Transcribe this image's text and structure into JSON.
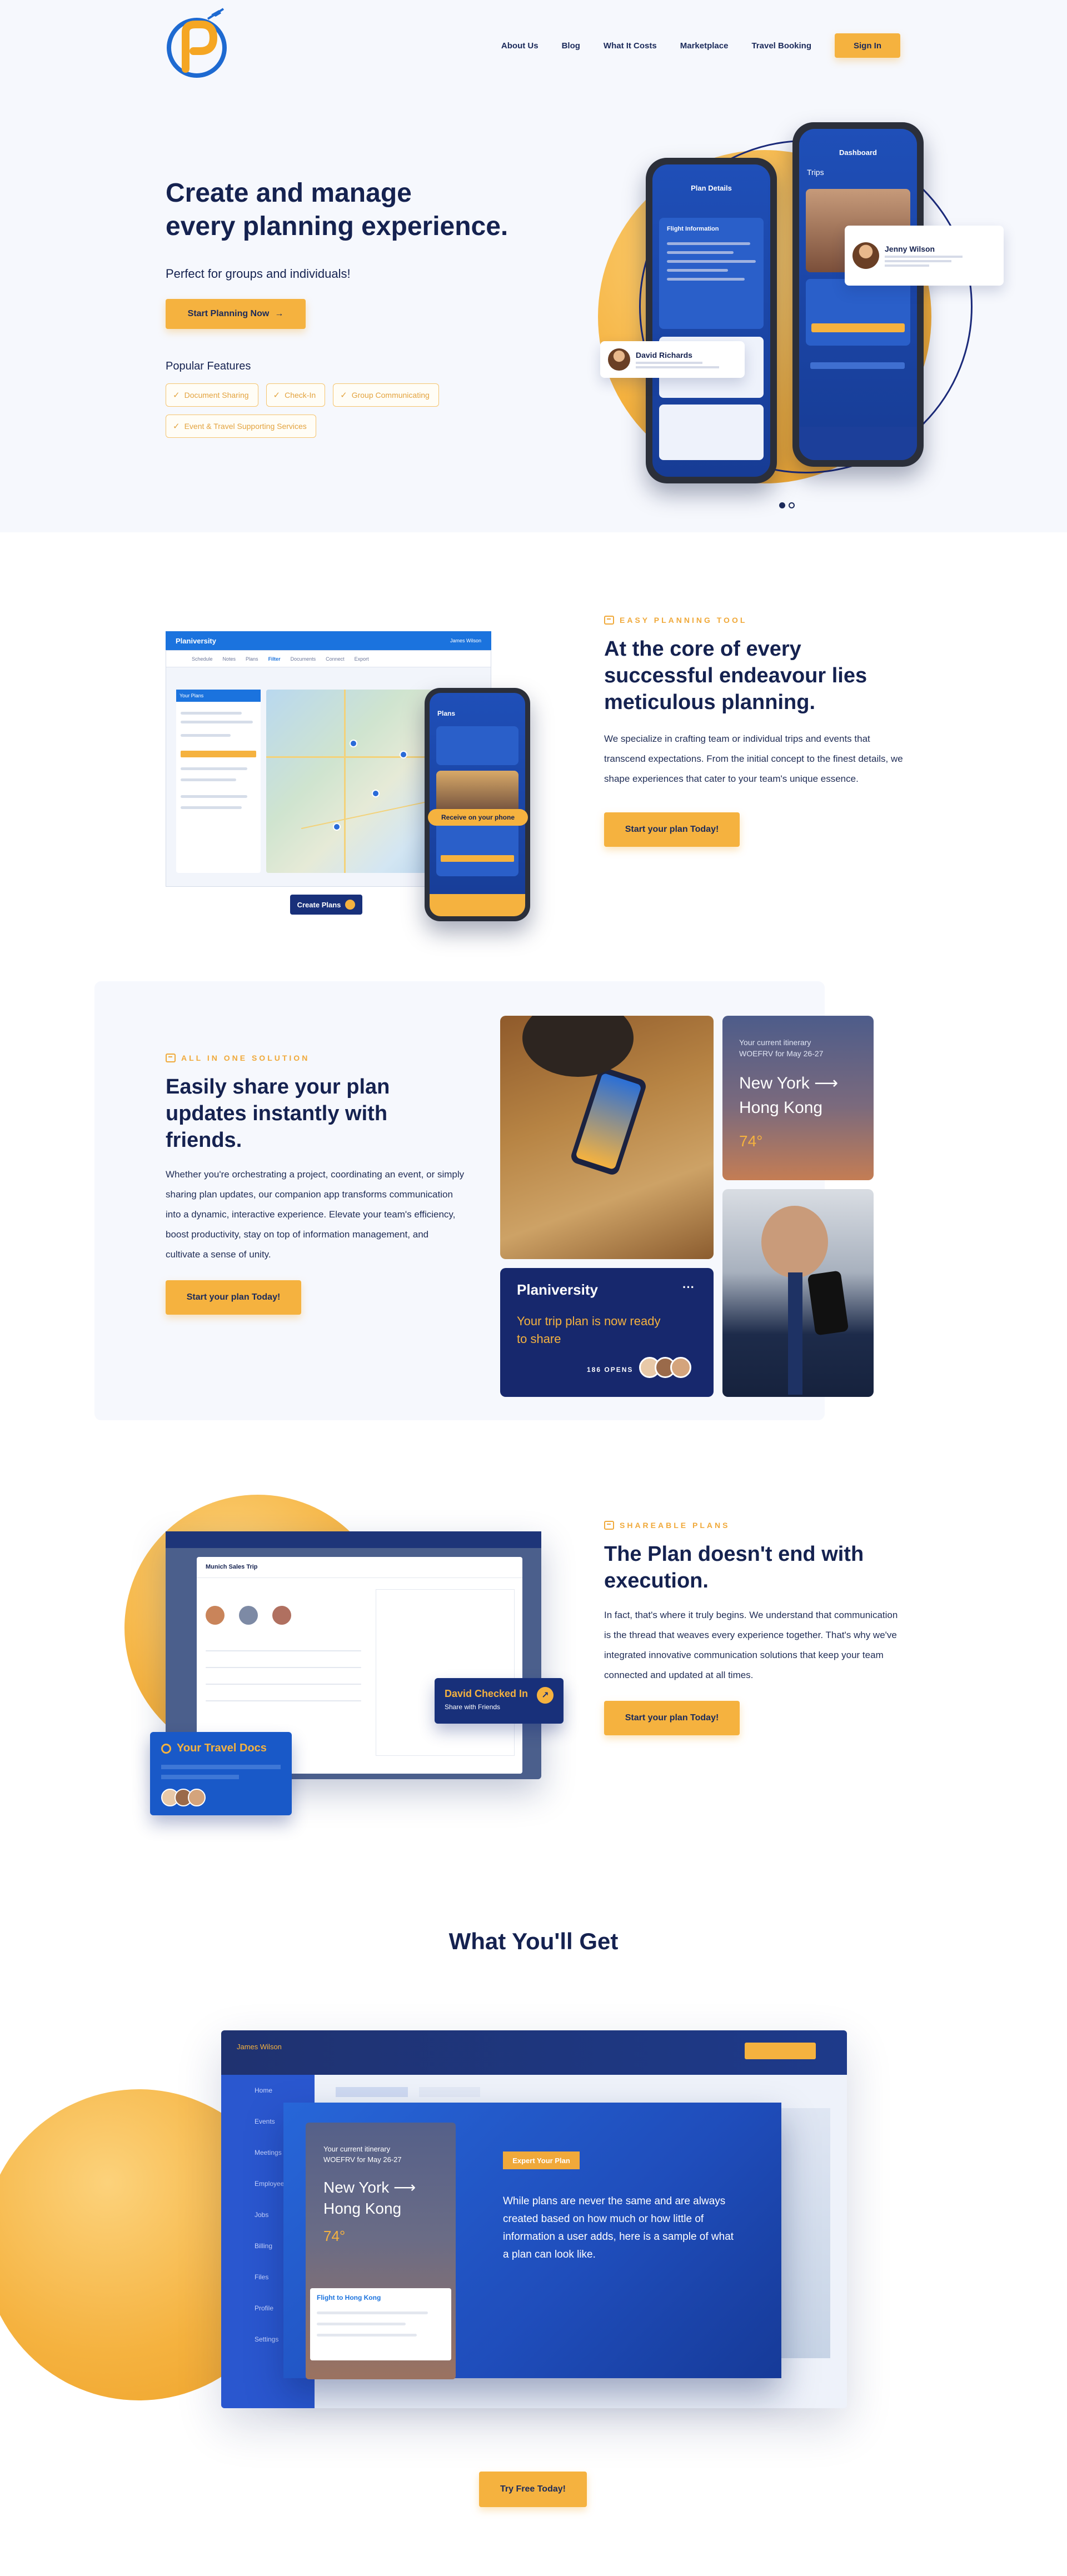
{
  "nav": {
    "links": [
      "About Us",
      "Blog",
      "What It Costs",
      "Marketplace",
      "Travel Booking"
    ],
    "signin": "Sign In"
  },
  "hero": {
    "title_line1": "Create and manage",
    "title_line2": "every planning experience.",
    "subtitle": "Perfect for groups and individuals!",
    "cta": "Start Planning Now",
    "popular_title": "Popular Features",
    "features": [
      "Document Sharing",
      "Check-In",
      "Group Communicating",
      "Event & Travel Supporting Services"
    ],
    "phone_left_title": "Plan Details",
    "phone_left_section": "Flight Information",
    "phone_right_title": "Dashboard",
    "phone_right_tab": "Trips",
    "card_david_name": "David Richards",
    "card_jenny_name": "Jenny Wilson"
  },
  "section1": {
    "eyebrow": "EASY PLANNING TOOL",
    "title": "At the core of every successful endeavour lies meticulous planning.",
    "body": "We specialize in crafting team or individual trips and events that transcend expectations. From the initial concept to the finest details, we shape experiences that cater to your team's unique essence.",
    "cta": "Start your plan Today!",
    "app_name": "Planiversity",
    "user_name": "James Wilson",
    "tabs": [
      "Schedule",
      "Notes",
      "Plans",
      "Filter",
      "Documents",
      "Connect",
      "Export"
    ],
    "panel_title": "Your Plans",
    "create_label": "Create Plans",
    "receive_label": "Receive on your phone",
    "phone_title": "Plans"
  },
  "section2": {
    "eyebrow": "ALL IN ONE SOLUTION",
    "title": "Easily share your plan updates instantly with friends.",
    "body": "Whether you're orchestrating a project, coordinating an event, or simply sharing plan updates, our companion app transforms communication into a dynamic, interactive experience. Elevate your team's efficiency, boost productivity, stay on top of information management, and cultivate a sense of unity.",
    "cta": "Start your plan Today!",
    "itinerary_label": "Your current itinerary",
    "itinerary_code": "WOEFRV for May 26-27",
    "city_from": "New York",
    "city_to": "Hong Kong",
    "temp": "74°",
    "brand": "Planiversity",
    "message": "Your trip plan is now ready to share",
    "opens": "186 OPENS"
  },
  "section3": {
    "eyebrow": "SHAREABLE PLANS",
    "title": "The Plan doesn't end with execution.",
    "body": "In fact, that's where it truly begins. We understand that communication is the thread that weaves every experience together. That's why we've integrated innovative communication solutions that keep your team connected and updated at all times.",
    "cta": "Start your plan Today!",
    "trip_name": "Munich Sales Trip",
    "docs_label": "Your Travel Docs",
    "checked_title": "David Checked In",
    "checked_sub": "Share with Friends"
  },
  "wyg": {
    "title": "What You'll Get",
    "user": "James Wilson",
    "side_items": [
      "Home",
      "Events",
      "Meetings",
      "Employees",
      "Jobs",
      "Billing",
      "Files",
      "Profile",
      "Settings"
    ],
    "expert_label": "Expert Your Plan",
    "text": "While plans are never the same and are always created based on how much or how little of information a user adds, here is a sample of what a plan can look like.",
    "flight": "Flight to Hong Kong",
    "cta": "Try Free Today!"
  }
}
